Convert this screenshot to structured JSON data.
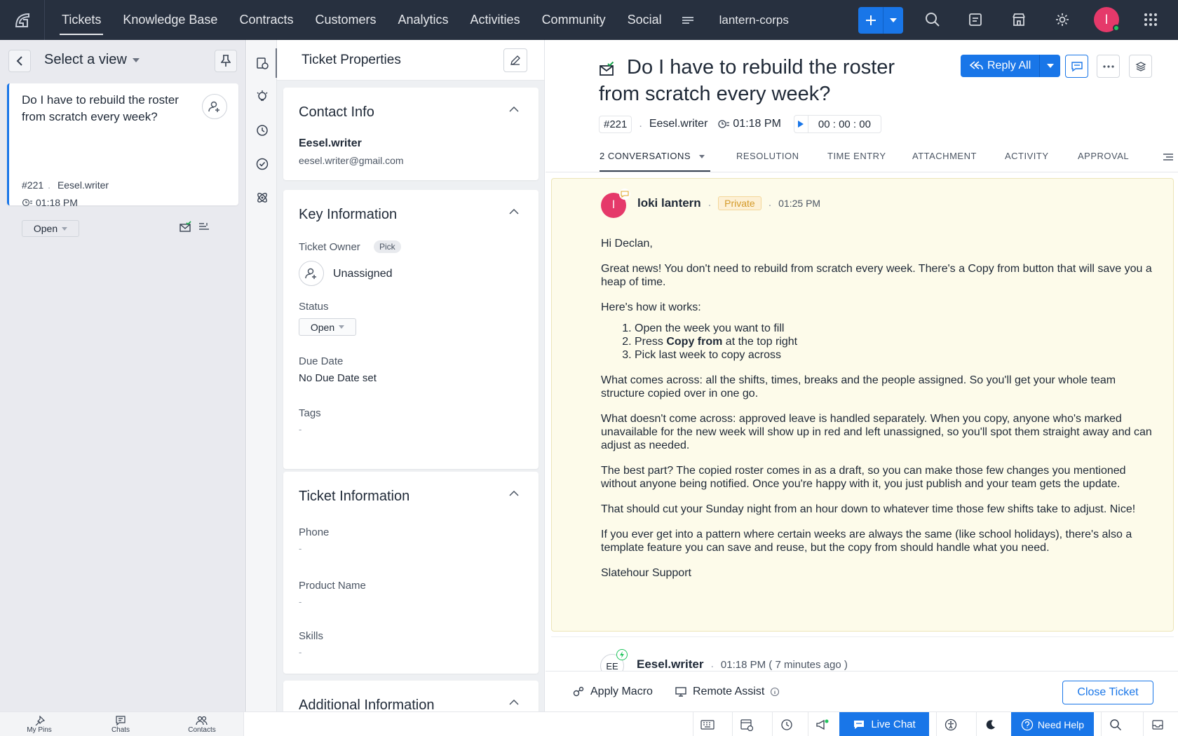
{
  "nav": {
    "items": [
      "Tickets",
      "Knowledge Base",
      "Contracts",
      "Customers",
      "Analytics",
      "Activities",
      "Community",
      "Social"
    ],
    "active": "Tickets",
    "org": "lantern-corps",
    "avatar_initial": "l",
    "icons": [
      "app-logo-icon",
      "more-menu-icon",
      "plus-icon",
      "caret-down-icon",
      "search-icon",
      "notes-icon",
      "store-icon",
      "gear-icon",
      "apps-grid-icon"
    ]
  },
  "left": {
    "view_label": "Select a view",
    "ticket": {
      "subject": "Do I have to rebuild the roster from scratch every week?",
      "id": "#221",
      "author": "Eesel.writer",
      "time": "01:18 PM",
      "status": "Open"
    }
  },
  "props": {
    "title": "Ticket Properties",
    "contact": {
      "title": "Contact Info",
      "name": "Eesel.writer",
      "email": "eesel.writer@gmail.com"
    },
    "key": {
      "title": "Key Information",
      "owner_label": "Ticket Owner",
      "pick": "Pick",
      "owner": "Unassigned",
      "status_label": "Status",
      "status": "Open",
      "due_label": "Due Date",
      "due": "No Due Date set",
      "tags_label": "Tags",
      "tags": "-"
    },
    "ticket_info": {
      "title": "Ticket Information",
      "phone_label": "Phone",
      "phone": "-",
      "product_label": "Product Name",
      "product": "-",
      "skills_label": "Skills",
      "skills": "-"
    },
    "additional": {
      "title": "Additional Information"
    }
  },
  "main": {
    "subject": "Do I have to rebuild the roster from scratch every week?",
    "id": "#221",
    "author": "Eesel.writer",
    "time": "01:18 PM",
    "timer": "00 : 00 : 00",
    "reply_all": "Reply All",
    "tabs": [
      "2 CONVERSATIONS",
      "RESOLUTION",
      "TIME ENTRY",
      "ATTACHMENT",
      "ACTIVITY",
      "APPROVAL"
    ],
    "conversation": {
      "avatar_initial": "l",
      "name": "loki lantern",
      "badge": "Private",
      "time": "01:25 PM",
      "greeting": "Hi Declan,",
      "p1": "Great news! You don't need to rebuild from scratch every week. There's a Copy from button that will save you a heap of time.",
      "p2": "Here's how it works:",
      "step1": "Open the week you want to fill",
      "step2_pre": "Press ",
      "step2_bold": "Copy from",
      "step2_post": " at the top right",
      "step3": "Pick last week to copy across",
      "p3": "What comes across: all the shifts, times, breaks and the people assigned. So you'll get your whole team structure copied over in one go.",
      "p4": "What doesn't come across: approved leave is handled separately. When you copy, anyone who's marked unavailable for the new week will show up in red and left unassigned, so you'll spot them straight away and can adjust as needed.",
      "p5": "The best part? The copied roster comes in as a draft, so you can make those few changes you mentioned without anyone being notified. Once you're happy with it, you just publish and your team gets the update.",
      "p6": "That should cut your Sunday night from an hour down to whatever time those few shifts take to adjust. Nice!",
      "p7": "If you ever get into a pattern where certain weeks are always the same (like school holidays), there's also a template feature you can save and reuse, but the copy from should handle what you need.",
      "signature": "Slatehour Support"
    },
    "conversation2": {
      "avatar_initials": "EE",
      "name": "Eesel.writer",
      "time": "01:18 PM ( 7 minutes ago )"
    },
    "actions": {
      "macro": "Apply Macro",
      "remote": "Remote Assist",
      "close": "Close Ticket"
    }
  },
  "bottom": {
    "my_pins": "My Pins",
    "chats": "Chats",
    "contacts": "Contacts",
    "live_chat": "Live Chat",
    "need_help": "Need Help"
  },
  "colors": {
    "nav_bg": "#27303f",
    "accent": "#1976e8",
    "avatar": "#e5396a",
    "private_note_bg": "#fdfbea"
  }
}
